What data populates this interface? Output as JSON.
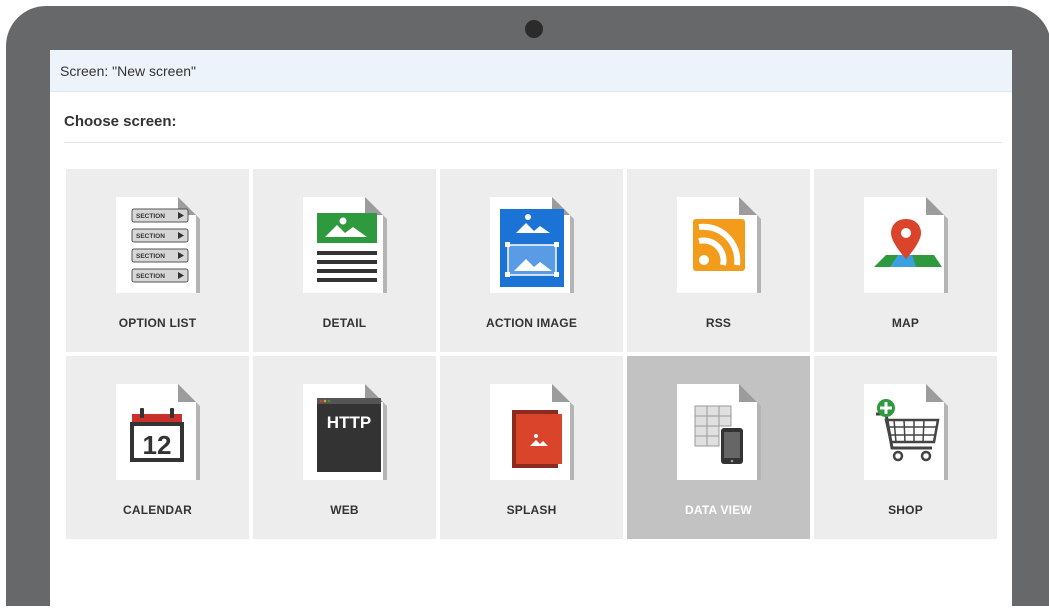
{
  "window": {
    "title": "Screen: \"New screen\""
  },
  "heading": "Choose screen:",
  "colors": {
    "bezel": "#67686a",
    "tile": "#ededed",
    "tile_selected": "#c2c2c2",
    "titlebar": "#edf3fa"
  },
  "tiles": [
    {
      "label": "OPTION LIST",
      "icon": "option-list-icon",
      "section_label": "SECTION"
    },
    {
      "label": "DETAIL",
      "icon": "detail-icon"
    },
    {
      "label": "ACTION IMAGE",
      "icon": "action-image-icon"
    },
    {
      "label": "RSS",
      "icon": "rss-icon"
    },
    {
      "label": "MAP",
      "icon": "map-icon"
    },
    {
      "label": "CALENDAR",
      "icon": "calendar-icon",
      "day": "12"
    },
    {
      "label": "WEB",
      "icon": "web-icon",
      "text": "HTTP"
    },
    {
      "label": "SPLASH",
      "icon": "splash-icon"
    },
    {
      "label": "DATA VIEW",
      "icon": "data-view-icon",
      "selected": true
    },
    {
      "label": "SHOP",
      "icon": "shop-icon"
    }
  ]
}
